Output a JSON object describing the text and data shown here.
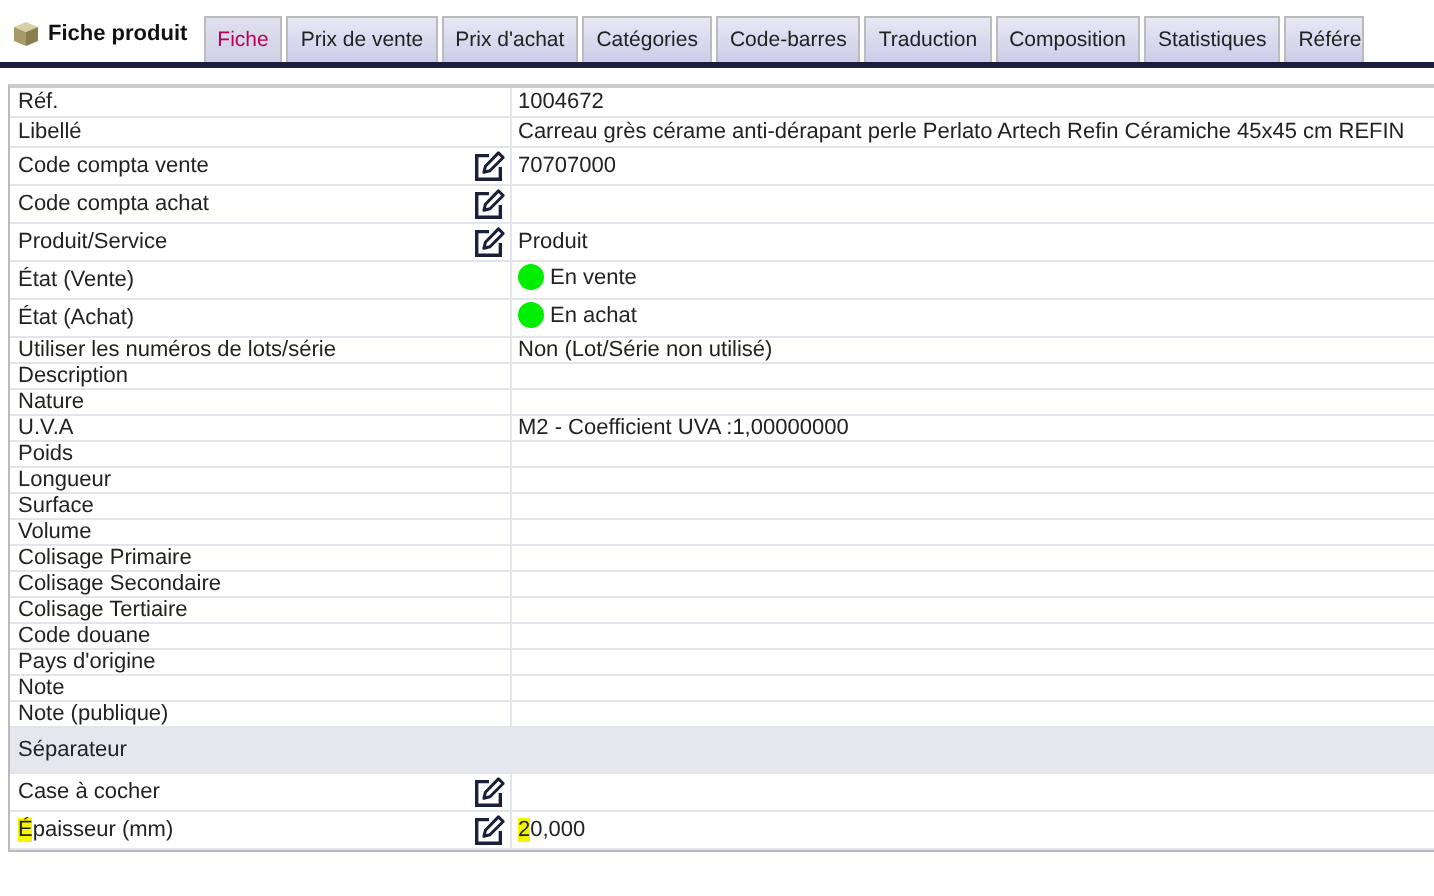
{
  "header": {
    "title": "Fiche produit"
  },
  "tabs": [
    {
      "label": "Fiche",
      "selected": true
    },
    {
      "label": "Prix de vente",
      "selected": false
    },
    {
      "label": "Prix d'achat",
      "selected": false
    },
    {
      "label": "Catégories",
      "selected": false
    },
    {
      "label": "Code-barres",
      "selected": false
    },
    {
      "label": "Traduction",
      "selected": false
    },
    {
      "label": "Composition",
      "selected": false
    },
    {
      "label": "Statistiques",
      "selected": false
    },
    {
      "label": "Référe",
      "selected": false
    }
  ],
  "rows": [
    {
      "kind": "field",
      "label": "Réf.",
      "value": "1004672",
      "editable": false
    },
    {
      "kind": "field",
      "label": "Libellé",
      "value": "Carreau grès cérame anti-dérapant perle Perlato Artech Refin Céramiche 45x45 cm REFIN",
      "editable": false
    },
    {
      "kind": "field",
      "label": "Code compta vente",
      "value": "70707000",
      "editable": true
    },
    {
      "kind": "field",
      "label": "Code compta achat",
      "editable": true
    },
    {
      "kind": "field",
      "label": "Produit/Service",
      "value": "Produit",
      "editable": true
    },
    {
      "kind": "status",
      "label": "État (Vente)",
      "value": "En vente",
      "color": "#00ee00",
      "editable": false
    },
    {
      "kind": "status",
      "label": "État (Achat)",
      "value": "En achat",
      "color": "#00ee00",
      "editable": false
    },
    {
      "kind": "field",
      "label": "Utiliser les numéros de lots/série",
      "value": "Non (Lot/Série non utilisé)",
      "editable": false
    },
    {
      "kind": "field",
      "label": "Description",
      "editable": false
    },
    {
      "kind": "field",
      "label": "Nature",
      "editable": false
    },
    {
      "kind": "field",
      "label": "U.V.A",
      "value": "M2  -  Coefficient UVA  :1,00000000",
      "editable": false
    },
    {
      "kind": "field",
      "label": "Poids",
      "editable": false
    },
    {
      "kind": "field",
      "label": "Longueur",
      "editable": false
    },
    {
      "kind": "field",
      "label": "Surface",
      "editable": false
    },
    {
      "kind": "field",
      "label": "Volume",
      "editable": false
    },
    {
      "kind": "field",
      "label": "Colisage Primaire",
      "editable": false
    },
    {
      "kind": "field",
      "label": "Colisage Secondaire",
      "editable": false
    },
    {
      "kind": "field",
      "label": "Colisage Tertiaire",
      "editable": false
    },
    {
      "kind": "field",
      "label": "Code douane",
      "editable": false
    },
    {
      "kind": "field",
      "label": "Pays d'origine",
      "editable": false
    },
    {
      "kind": "field",
      "label": "Note",
      "editable": false
    },
    {
      "kind": "field",
      "label": "Note (publique)",
      "editable": false
    },
    {
      "kind": "separator",
      "label": "Séparateur"
    },
    {
      "kind": "field",
      "label": "Case à cocher",
      "editable": true
    },
    {
      "kind": "field",
      "label_mark": "É",
      "label": "paisseur (mm)",
      "value_mark": "2",
      "value": "0,000",
      "editable": true
    }
  ]
}
